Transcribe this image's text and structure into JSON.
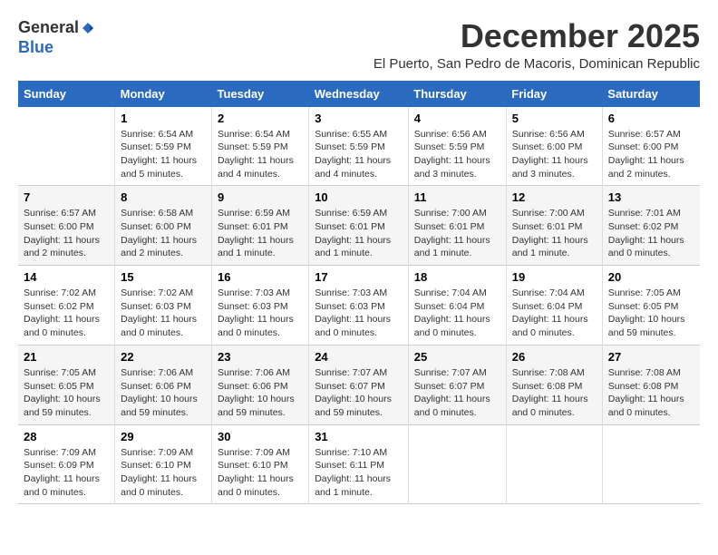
{
  "logo": {
    "general": "General",
    "blue": "Blue"
  },
  "title": "December 2025",
  "subtitle": "El Puerto, San Pedro de Macoris, Dominican Republic",
  "days_of_week": [
    "Sunday",
    "Monday",
    "Tuesday",
    "Wednesday",
    "Thursday",
    "Friday",
    "Saturday"
  ],
  "weeks": [
    [
      {
        "day": "",
        "info": ""
      },
      {
        "day": "1",
        "info": "Sunrise: 6:54 AM\nSunset: 5:59 PM\nDaylight: 11 hours\nand 5 minutes."
      },
      {
        "day": "2",
        "info": "Sunrise: 6:54 AM\nSunset: 5:59 PM\nDaylight: 11 hours\nand 4 minutes."
      },
      {
        "day": "3",
        "info": "Sunrise: 6:55 AM\nSunset: 5:59 PM\nDaylight: 11 hours\nand 4 minutes."
      },
      {
        "day": "4",
        "info": "Sunrise: 6:56 AM\nSunset: 5:59 PM\nDaylight: 11 hours\nand 3 minutes."
      },
      {
        "day": "5",
        "info": "Sunrise: 6:56 AM\nSunset: 6:00 PM\nDaylight: 11 hours\nand 3 minutes."
      },
      {
        "day": "6",
        "info": "Sunrise: 6:57 AM\nSunset: 6:00 PM\nDaylight: 11 hours\nand 2 minutes."
      }
    ],
    [
      {
        "day": "7",
        "info": "Sunrise: 6:57 AM\nSunset: 6:00 PM\nDaylight: 11 hours\nand 2 minutes."
      },
      {
        "day": "8",
        "info": "Sunrise: 6:58 AM\nSunset: 6:00 PM\nDaylight: 11 hours\nand 2 minutes."
      },
      {
        "day": "9",
        "info": "Sunrise: 6:59 AM\nSunset: 6:01 PM\nDaylight: 11 hours\nand 1 minute."
      },
      {
        "day": "10",
        "info": "Sunrise: 6:59 AM\nSunset: 6:01 PM\nDaylight: 11 hours\nand 1 minute."
      },
      {
        "day": "11",
        "info": "Sunrise: 7:00 AM\nSunset: 6:01 PM\nDaylight: 11 hours\nand 1 minute."
      },
      {
        "day": "12",
        "info": "Sunrise: 7:00 AM\nSunset: 6:01 PM\nDaylight: 11 hours\nand 1 minute."
      },
      {
        "day": "13",
        "info": "Sunrise: 7:01 AM\nSunset: 6:02 PM\nDaylight: 11 hours\nand 0 minutes."
      }
    ],
    [
      {
        "day": "14",
        "info": "Sunrise: 7:02 AM\nSunset: 6:02 PM\nDaylight: 11 hours\nand 0 minutes."
      },
      {
        "day": "15",
        "info": "Sunrise: 7:02 AM\nSunset: 6:03 PM\nDaylight: 11 hours\nand 0 minutes."
      },
      {
        "day": "16",
        "info": "Sunrise: 7:03 AM\nSunset: 6:03 PM\nDaylight: 11 hours\nand 0 minutes."
      },
      {
        "day": "17",
        "info": "Sunrise: 7:03 AM\nSunset: 6:03 PM\nDaylight: 11 hours\nand 0 minutes."
      },
      {
        "day": "18",
        "info": "Sunrise: 7:04 AM\nSunset: 6:04 PM\nDaylight: 11 hours\nand 0 minutes."
      },
      {
        "day": "19",
        "info": "Sunrise: 7:04 AM\nSunset: 6:04 PM\nDaylight: 11 hours\nand 0 minutes."
      },
      {
        "day": "20",
        "info": "Sunrise: 7:05 AM\nSunset: 6:05 PM\nDaylight: 10 hours\nand 59 minutes."
      }
    ],
    [
      {
        "day": "21",
        "info": "Sunrise: 7:05 AM\nSunset: 6:05 PM\nDaylight: 10 hours\nand 59 minutes."
      },
      {
        "day": "22",
        "info": "Sunrise: 7:06 AM\nSunset: 6:06 PM\nDaylight: 10 hours\nand 59 minutes."
      },
      {
        "day": "23",
        "info": "Sunrise: 7:06 AM\nSunset: 6:06 PM\nDaylight: 10 hours\nand 59 minutes."
      },
      {
        "day": "24",
        "info": "Sunrise: 7:07 AM\nSunset: 6:07 PM\nDaylight: 10 hours\nand 59 minutes."
      },
      {
        "day": "25",
        "info": "Sunrise: 7:07 AM\nSunset: 6:07 PM\nDaylight: 11 hours\nand 0 minutes."
      },
      {
        "day": "26",
        "info": "Sunrise: 7:08 AM\nSunset: 6:08 PM\nDaylight: 11 hours\nand 0 minutes."
      },
      {
        "day": "27",
        "info": "Sunrise: 7:08 AM\nSunset: 6:08 PM\nDaylight: 11 hours\nand 0 minutes."
      }
    ],
    [
      {
        "day": "28",
        "info": "Sunrise: 7:09 AM\nSunset: 6:09 PM\nDaylight: 11 hours\nand 0 minutes."
      },
      {
        "day": "29",
        "info": "Sunrise: 7:09 AM\nSunset: 6:10 PM\nDaylight: 11 hours\nand 0 minutes."
      },
      {
        "day": "30",
        "info": "Sunrise: 7:09 AM\nSunset: 6:10 PM\nDaylight: 11 hours\nand 0 minutes."
      },
      {
        "day": "31",
        "info": "Sunrise: 7:10 AM\nSunset: 6:11 PM\nDaylight: 11 hours\nand 1 minute."
      },
      {
        "day": "",
        "info": ""
      },
      {
        "day": "",
        "info": ""
      },
      {
        "day": "",
        "info": ""
      }
    ]
  ]
}
